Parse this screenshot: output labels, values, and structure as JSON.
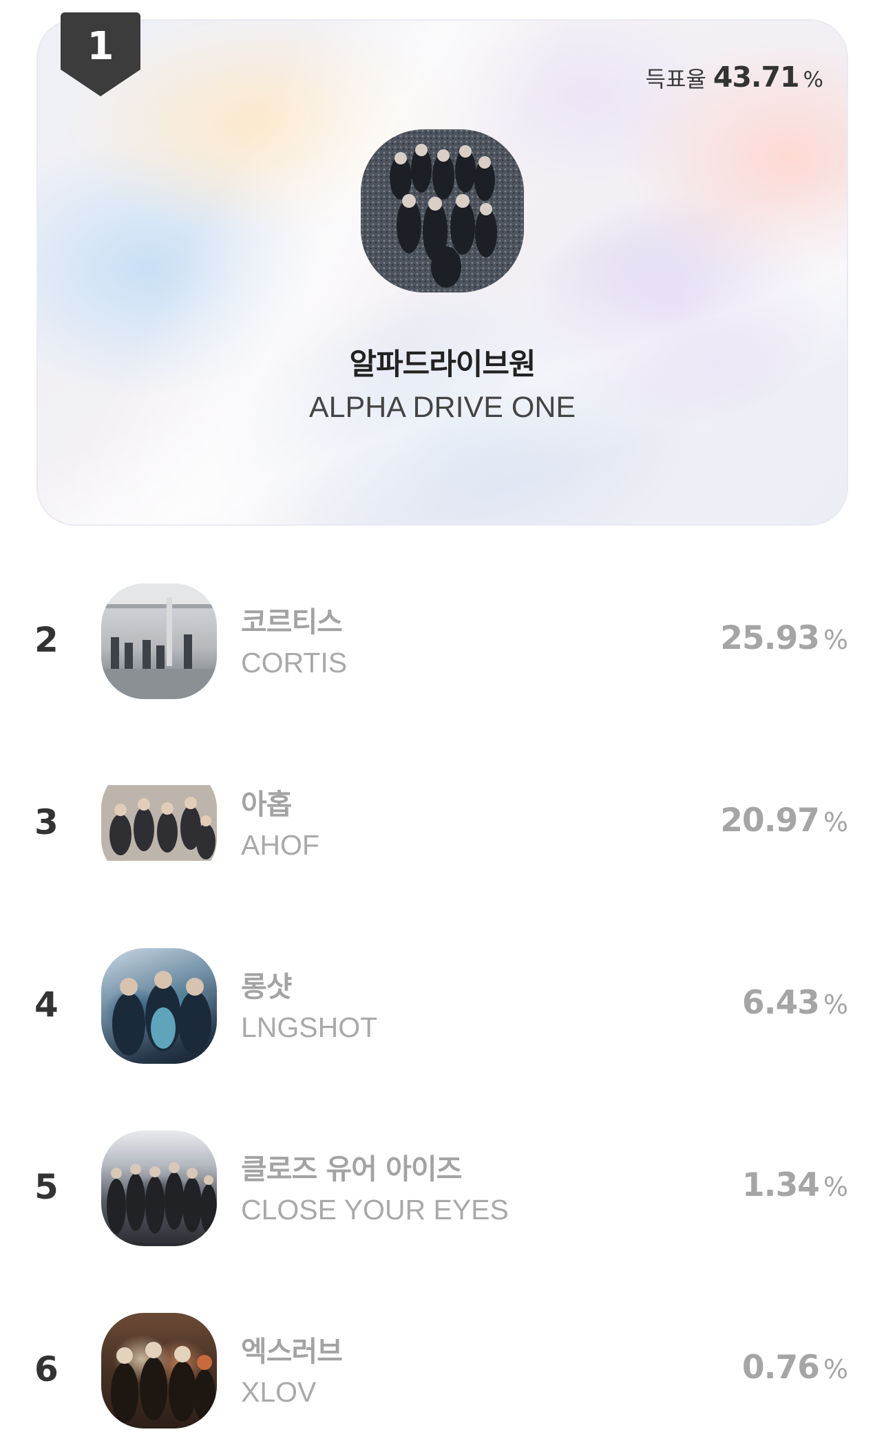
{
  "winner": {
    "rank": "1",
    "vote_rate_label": "득표율",
    "vote_rate_value": "43.71",
    "vote_rate_unit": "%",
    "name_ko": "알파드라이브원",
    "name_en": "ALPHA DRIVE ONE"
  },
  "rankings": [
    {
      "rank": "2",
      "name_ko": "코르티스",
      "name_en": "CORTIS",
      "percent": "25.93",
      "unit": "%"
    },
    {
      "rank": "3",
      "name_ko": "아홉",
      "name_en": "AHOF",
      "percent": "20.97",
      "unit": "%"
    },
    {
      "rank": "4",
      "name_ko": "롱샷",
      "name_en": "LNGSHOT",
      "percent": "6.43",
      "unit": "%"
    },
    {
      "rank": "5",
      "name_ko": "클로즈 유어 아이즈",
      "name_en": "CLOSE YOUR EYES",
      "percent": "1.34",
      "unit": "%"
    },
    {
      "rank": "6",
      "name_ko": "엑스러브",
      "name_en": "XLOV",
      "percent": "0.76",
      "unit": "%"
    }
  ],
  "colors": {
    "badge": "#3c3c3c",
    "primary_text": "#333333",
    "muted_text": "#a5a5a5"
  }
}
